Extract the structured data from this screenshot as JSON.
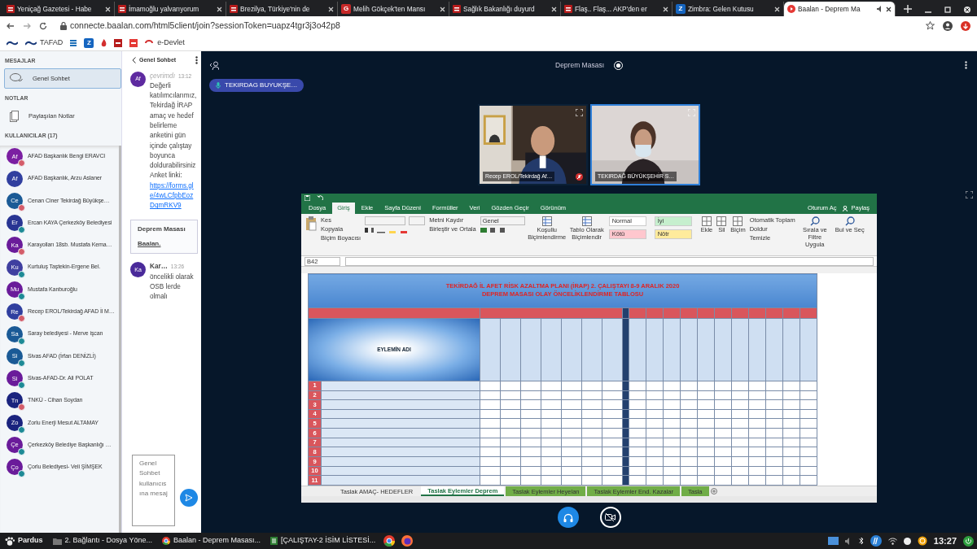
{
  "browser": {
    "tabs": [
      {
        "title": "Yeniçağ Gazetesi - Habe",
        "kind": "news",
        "selected": false
      },
      {
        "title": "İmamoğlu yalvarıyorum",
        "kind": "news",
        "selected": false
      },
      {
        "title": "Brezilya, Türkiye'nin de",
        "kind": "news",
        "selected": false
      },
      {
        "title": "Melih Gökçek'ten Mansı",
        "kind": "letter",
        "badge": "G",
        "selected": false
      },
      {
        "title": "Sağlık Bakanlığı duyurd",
        "kind": "news",
        "selected": false
      },
      {
        "title": "Flaş.. Flaş... AKP'den er",
        "kind": "news",
        "selected": false
      },
      {
        "title": "Zimbra: Gelen Kutusu",
        "kind": "letter",
        "badge": "Z",
        "selected": false
      },
      {
        "title": "Baalan - Deprem Ma",
        "kind": "play",
        "selected": true
      }
    ],
    "url": "connecte.baalan.com/html5client/join?sessionToken=uapz4tgr3j3o42p8",
    "bookmarks": [
      {
        "kind": "logo"
      },
      {
        "kind": "logo",
        "label": "TAFAD"
      },
      {
        "kind": "stripes"
      },
      {
        "kind": "letter",
        "badge": "Z"
      },
      {
        "kind": "flame"
      },
      {
        "kind": "square"
      },
      {
        "kind": "square"
      },
      {
        "kind": "swirl",
        "label": "e-Devlet"
      }
    ]
  },
  "sidebar": {
    "messages_title": "MESAJLAR",
    "chats": [
      {
        "label": "Genel Sohbet",
        "selected": true
      }
    ],
    "notes_title": "NOTLAR",
    "notes": [
      {
        "label": "Paylaşılan Notlar"
      }
    ],
    "users_title": "KULLANICILAR (17)",
    "users": [
      {
        "initials": "Af",
        "name": "AFAD Başkanlık Bengi ERAVCI",
        "color": "#7b1fa2",
        "kind": "muted"
      },
      {
        "initials": "Af",
        "name": "AFAD Başkanlık, Arzu Aslaner",
        "color": "#303f9f",
        "kind": "plain"
      },
      {
        "initials": "Ce",
        "name": "Cenan Ciner Tekirdağ Büyükşe…",
        "color": "#1a5a96",
        "kind": "muted"
      },
      {
        "initials": "Er",
        "name": "Ercan KAYA Çerkezköy Belediyesi",
        "color": "#283593",
        "kind": "listener"
      },
      {
        "initials": "Ka",
        "name": "Karayolları 18sb. Mustafa Kema…",
        "color": "#6a1b9a",
        "kind": "muted"
      },
      {
        "initials": "Ku",
        "name": "Kurtuluş Taştekin-Ergene Bel.",
        "color": "#3f3fa0",
        "kind": "listener"
      },
      {
        "initials": "Mu",
        "name": "Mustafa Kanburoğlu",
        "color": "#6a1b9a",
        "kind": "listener"
      },
      {
        "initials": "Re",
        "name": "Recep EROL/Tekirdağ AFAD İl M…",
        "color": "#303f9f",
        "kind": "muted"
      },
      {
        "initials": "Sa",
        "name": "Saray belediyesi - Merve işcan",
        "color": "#1a5a96",
        "kind": "listener"
      },
      {
        "initials": "Si",
        "name": "Sivas AFAD (İrfan DENİZLİ)",
        "color": "#1a5a96",
        "kind": "listener"
      },
      {
        "initials": "Si",
        "name": "Sivas-AFAD-Dr. Ali POLAT",
        "color": "#6a1b9a",
        "kind": "listener"
      },
      {
        "initials": "Tn",
        "name": "TNKÜ - Cihan Soydan",
        "color": "#1a237e",
        "kind": "muted"
      },
      {
        "initials": "Zo",
        "name": "Zorlu Enerji Mesut ALTAMAY",
        "color": "#1a237e",
        "kind": "listener"
      },
      {
        "initials": "Çe",
        "name": "Çerkezköy Belediye Başkanlığı …",
        "color": "#6a1b9a",
        "kind": "listener"
      },
      {
        "initials": "Ço",
        "name": "Çorlu Belediyesi- Veli ŞİMŞEK",
        "color": "#6a1b9a",
        "kind": "listener"
      }
    ]
  },
  "chat": {
    "title": "Genel Sohbet",
    "messages": [
      {
        "initials": "Af",
        "sender": "çevrimdı",
        "time": "13:12",
        "color": "#5e2aa0",
        "text": "Değerli katılımcılarımız, Tekirdağ İRAP amaç ve hedef belirleme anketini gün içinde çalıştay boyunca doldurabilirsiniz",
        "link_label": "Anket linki:",
        "link": "https://forms.gle/4wLCfpbEozDqmRKV9"
      },
      {
        "kind": "pinned",
        "title": "Deprem Masası",
        "text": "Baalan."
      },
      {
        "initials": "Ka",
        "sender": "Kar…",
        "time": "13:26",
        "color": "#4a2a9a",
        "text": "öncelikli olarak OSB lerde olmalı"
      }
    ],
    "placeholder": "Genel Sohbet kullanıcısına mesaj"
  },
  "meeting": {
    "title": "Deprem Masası",
    "recording": true,
    "talker": "TEKIRDAG BUYUKŞE…",
    "videos": [
      {
        "name": "Recep EROL/Tekirdağ Af…",
        "muted": true,
        "talking": false
      },
      {
        "name": "TEKIRDAĞ BÜYÜKŞEHİR S…",
        "muted": false,
        "talking": true
      }
    ],
    "controls": [
      {
        "kind": "audio",
        "on": true
      },
      {
        "kind": "video",
        "on": false
      }
    ]
  },
  "shared_screen": {
    "ribbon_tabs": [
      {
        "label": "Dosya",
        "selected": false
      },
      {
        "label": "Giriş",
        "selected": true
      },
      {
        "label": "Ekle",
        "selected": false
      },
      {
        "label": "Sayfa Düzeni",
        "selected": false
      },
      {
        "label": "Formüller",
        "selected": false
      },
      {
        "label": "Veri",
        "selected": false
      },
      {
        "label": "Gözden Geçir",
        "selected": false
      },
      {
        "label": "Görünüm",
        "selected": false
      }
    ],
    "account": "Oturum Aç",
    "share": "Paylaş",
    "clipboard": [
      "Kes",
      "Kopyala",
      "Biçim Boyacısı"
    ],
    "alignment": [
      "Metni Kaydır",
      "Birleştir ve Ortala"
    ],
    "number_format": "Genel",
    "format_buttons": [
      "Koşullu Biçimlendirme",
      "Tablo Olarak Biçimlendir"
    ],
    "styles": [
      {
        "label": "Normal",
        "color": "#ffffff"
      },
      {
        "label": "İyi",
        "color": "#c6efce"
      },
      {
        "label": "Kötü",
        "color": "#ffc7ce"
      },
      {
        "label": "Nötr",
        "color": "#ffeb9c"
      }
    ],
    "cells_buttons": [
      "Ekle",
      "Sil",
      "Biçim"
    ],
    "editing": [
      "Otomatik Toplam",
      "Doldur",
      "Temizle"
    ],
    "editing_buttons": [
      "Sırala ve Filtre Uygula",
      "Bul ve Seç"
    ],
    "name_box": "B42",
    "sheet_title": [
      "TEKİRDAĞ İL AFET RİSK AZALTMA PLANI (İRAP) 2. ÇALIŞTAYI 8-9 ARALIK 2020",
      "DEPREM MASASI OLAY ÖNCELİKLENDİRME TABLOSU"
    ],
    "action_header": "EYLEMİN ADI",
    "rows": [
      "1",
      "2",
      "3",
      "4",
      "5",
      "6",
      "7",
      "8",
      "9",
      "10",
      "11"
    ],
    "sheet_tabs": [
      {
        "label": "Taslak AMAÇ- HEDEFLER",
        "selected": false
      },
      {
        "label": "Taslak Eylemler Deprem",
        "selected": true
      },
      {
        "label": "Taslak Eylemler Heyelan",
        "selected": false,
        "color": "#70ad47"
      },
      {
        "label": "Taslak Eylemler End. Kazalar",
        "selected": false,
        "color": "#70ad47"
      },
      {
        "label": "Tasla",
        "selected": false,
        "color": "#70ad47"
      }
    ]
  },
  "taskbar": {
    "start": "Pardus",
    "windows": [
      {
        "label": "2. Bağlantı - Dosya Yöne...",
        "kind": "folder"
      },
      {
        "label": "Baalan - Deprem Masası...",
        "kind": "chrome"
      },
      {
        "label": "[ÇALIŞTAY-2 İSİM LİSTESİ...",
        "kind": "sheet"
      }
    ],
    "clock": "13:27"
  }
}
